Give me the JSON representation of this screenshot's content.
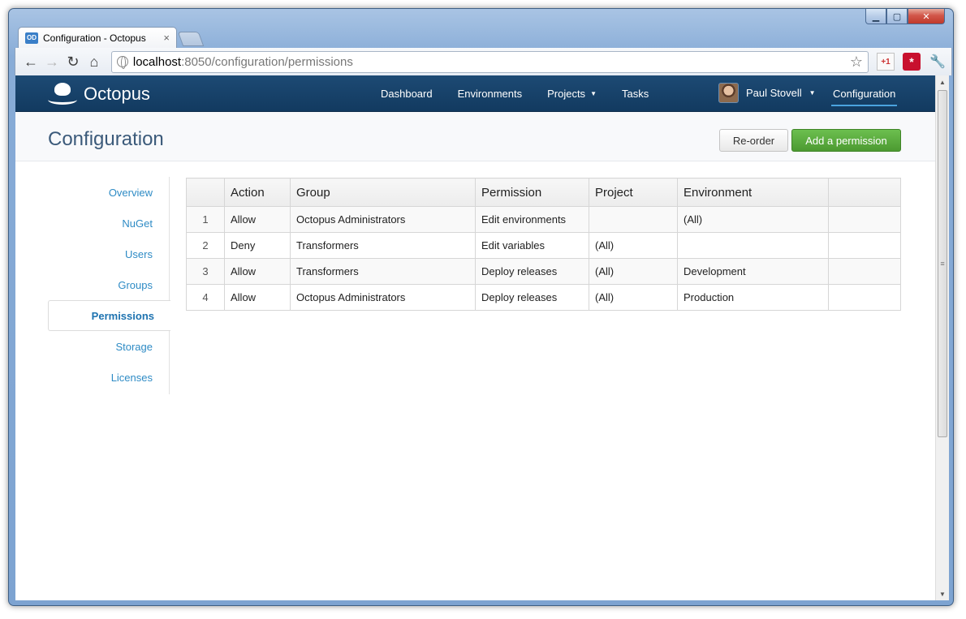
{
  "browser": {
    "tab_favicon": "OD",
    "tab_title": "Configuration - Octopus",
    "tab_close": "×",
    "url_host": "localhost",
    "url_rest": ":8050/configuration/permissions",
    "ext_gplus": "+1",
    "ext_red": "*"
  },
  "app": {
    "brand": "Octopus",
    "nav": [
      "Dashboard",
      "Environments",
      "Projects",
      "Tasks"
    ],
    "user_name": "Paul Stovell",
    "config_link": "Configuration"
  },
  "page": {
    "title": "Configuration",
    "reorder_label": "Re-order",
    "add_label": "Add a permission"
  },
  "sidemenu": [
    "Overview",
    "NuGet",
    "Users",
    "Groups",
    "Permissions",
    "Storage",
    "Licenses"
  ],
  "table": {
    "headers": [
      "",
      "Action",
      "Group",
      "Permission",
      "Project",
      "Environment",
      ""
    ],
    "rows": [
      [
        "1",
        "Allow",
        "Octopus Administrators",
        "Edit environments",
        "",
        "(All)",
        ""
      ],
      [
        "2",
        "Deny",
        "Transformers",
        "Edit variables",
        "(All)",
        "",
        ""
      ],
      [
        "3",
        "Allow",
        "Transformers",
        "Deploy releases",
        "(All)",
        "Development",
        ""
      ],
      [
        "4",
        "Allow",
        "Octopus Administrators",
        "Deploy releases",
        "(All)",
        "Production",
        ""
      ]
    ]
  },
  "colors": {
    "navbar": "#1d4a74",
    "accent_green": "#5aad3f",
    "link_blue": "#2e8bc5"
  }
}
